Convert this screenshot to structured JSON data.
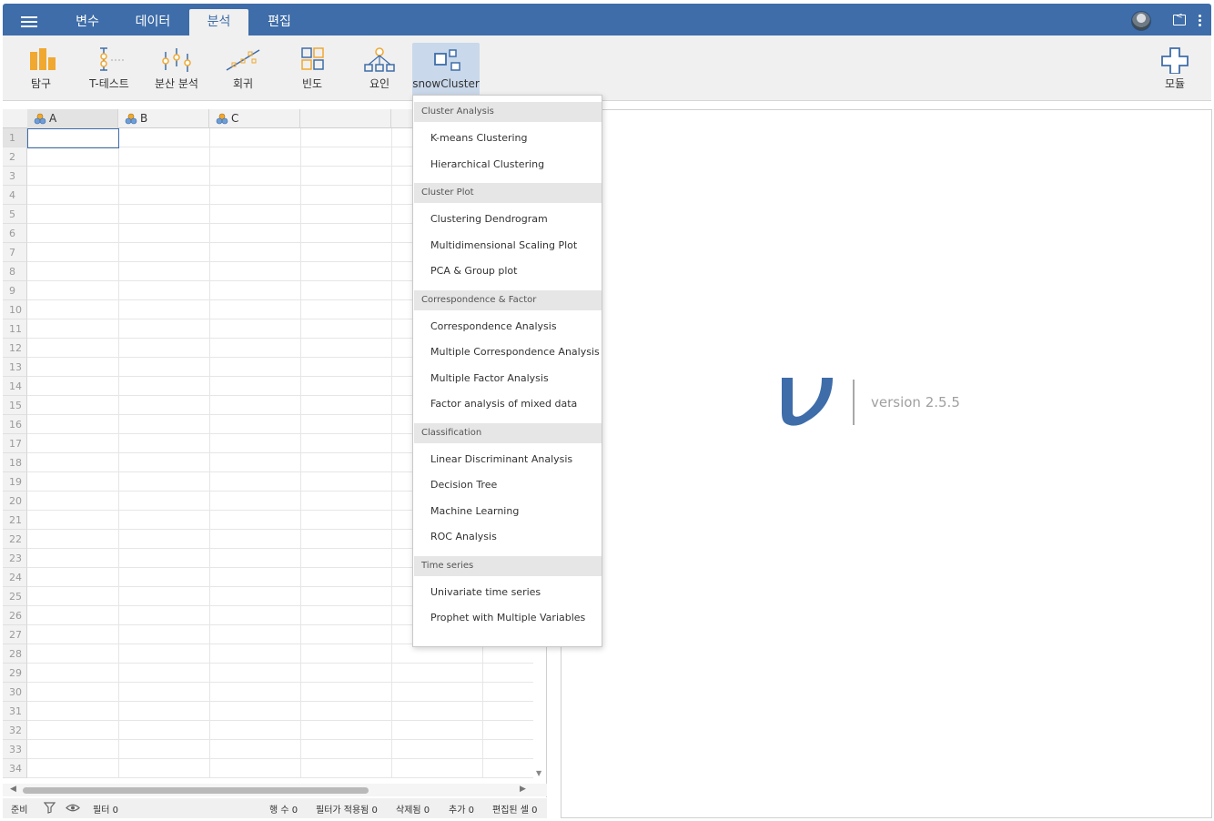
{
  "topbar": {
    "tabs": [
      {
        "label": "변수"
      },
      {
        "label": "데이터"
      },
      {
        "label": "분석",
        "active": true
      },
      {
        "label": "편집"
      }
    ]
  },
  "ribbon": {
    "buttons": [
      {
        "label": "탐구",
        "icon": "bar-chart-icon"
      },
      {
        "label": "T-테스트",
        "icon": "t-test-icon"
      },
      {
        "label": "분산 분석",
        "icon": "anova-icon"
      },
      {
        "label": "회귀",
        "icon": "regression-icon"
      },
      {
        "label": "빈도",
        "icon": "frequency-grid-icon"
      },
      {
        "label": "요인",
        "icon": "factor-tree-icon"
      },
      {
        "label": "snowCluster",
        "icon": "cluster-icon",
        "selected": true
      }
    ],
    "module_label": "모듈"
  },
  "sheet": {
    "columns": [
      "A",
      "B",
      "C"
    ],
    "rows": [
      "1",
      "2",
      "3",
      "4",
      "5",
      "6",
      "7",
      "8",
      "9",
      "10",
      "11",
      "12",
      "13",
      "14",
      "15",
      "16",
      "17",
      "18",
      "19",
      "20",
      "21",
      "22",
      "23",
      "24",
      "25",
      "26",
      "27",
      "28",
      "29",
      "30",
      "31",
      "32",
      "33",
      "34"
    ]
  },
  "statusbar": {
    "ready": "준비",
    "filter": "필터 0",
    "row_count": "행 수 0",
    "filtered": "필터가 적용됨 0",
    "deleted": "삭제됨 0",
    "added": "추가 0",
    "edited": "편집된 셀 0"
  },
  "results": {
    "version": "version 2.5.5"
  },
  "menu": {
    "groups": [
      {
        "title": "Cluster Analysis",
        "items": [
          "K-means Clustering",
          "Hierarchical Clustering"
        ]
      },
      {
        "title": "Cluster Plot",
        "items": [
          "Clustering Dendrogram",
          "Multidimensional Scaling Plot",
          "PCA & Group plot"
        ]
      },
      {
        "title": "Correspondence & Factor",
        "items": [
          "Correspondence Analysis",
          "Multiple Correspondence Analysis",
          "Multiple Factor Analysis",
          "Factor analysis of mixed data"
        ]
      },
      {
        "title": "Classification",
        "items": [
          "Linear Discriminant Analysis",
          "Decision Tree",
          "Machine Learning",
          "ROC Analysis"
        ]
      },
      {
        "title": "Time series",
        "items": [
          "Univariate time series",
          "Prophet with Multiple Variables"
        ]
      }
    ]
  },
  "colors": {
    "brand": "#3e6da9",
    "accent_orange": "#f0a830"
  }
}
